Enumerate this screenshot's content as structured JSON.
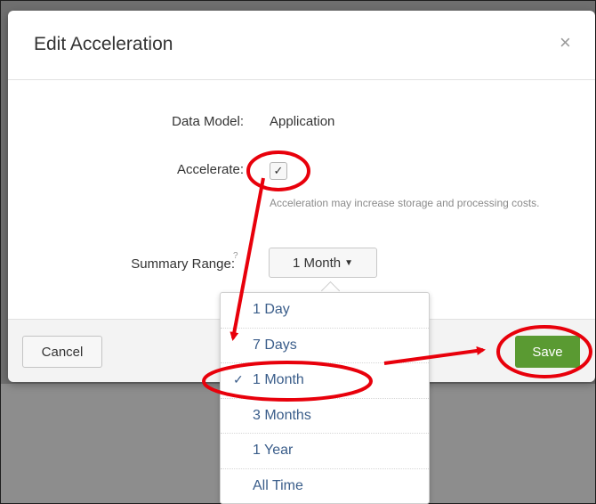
{
  "modal": {
    "title": "Edit Acceleration",
    "close_icon": "close-icon",
    "close_glyph": "×"
  },
  "form": {
    "data_model_label": "Data Model:",
    "data_model_value": "Application",
    "accelerate_label": "Accelerate:",
    "accelerate_checked": true,
    "help_text": "Acceleration may increase storage and processing costs.",
    "summary_range_label": "Summary Range:",
    "summary_range_help": "?",
    "summary_range_value": "1 Month"
  },
  "footer": {
    "cancel_label": "Cancel",
    "save_label": "Save"
  },
  "dropdown": {
    "options": [
      "1 Day",
      "7 Days",
      "1 Month",
      "3 Months",
      "1 Year",
      "All Time"
    ],
    "selected": "1 Month"
  },
  "annotation": {
    "color": "#e8000b"
  },
  "colors": {
    "save": "#5a9a32",
    "link": "#3a5d8a"
  }
}
